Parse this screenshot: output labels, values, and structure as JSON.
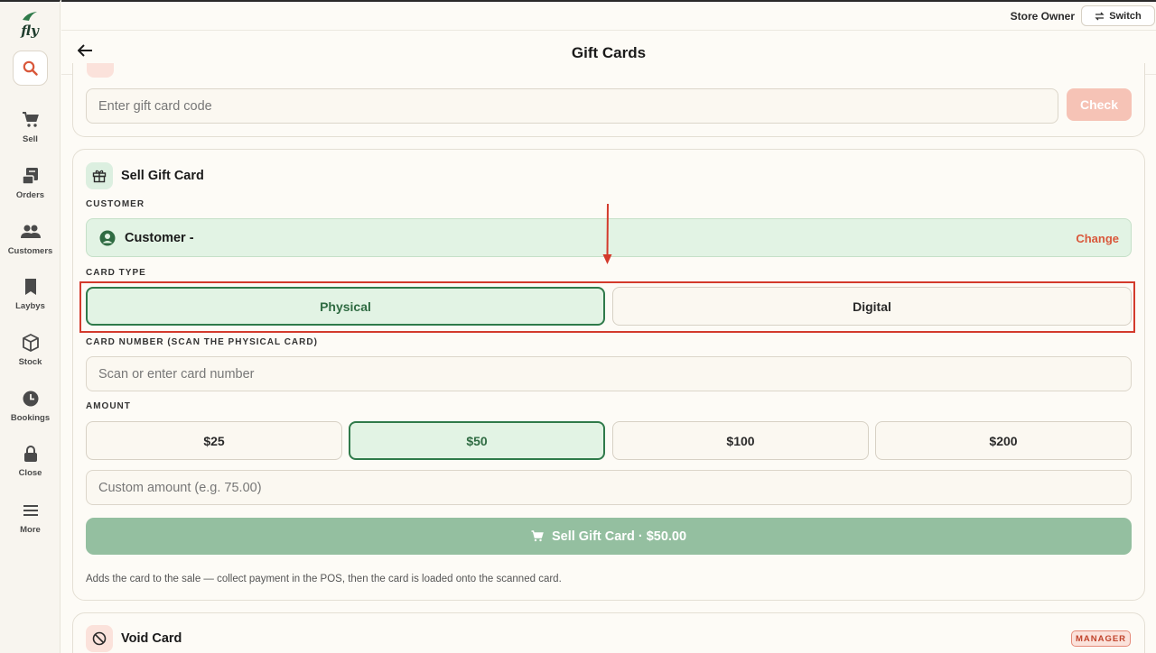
{
  "app": {
    "logo_text": "fly"
  },
  "sidebar": {
    "items": [
      {
        "label": "Sell",
        "icon": "cart-icon"
      },
      {
        "label": "Orders",
        "icon": "receipt-icon"
      },
      {
        "label": "Customers",
        "icon": "users-icon"
      },
      {
        "label": "Laybys",
        "icon": "bookmark-icon"
      },
      {
        "label": "Stock",
        "icon": "box-icon"
      },
      {
        "label": "Bookings",
        "icon": "clock-icon"
      },
      {
        "label": "Close",
        "icon": "lock-icon"
      },
      {
        "label": "More",
        "icon": "menu-icon"
      }
    ]
  },
  "topbar": {
    "user": "Store Owner",
    "switch_label": "Switch"
  },
  "header": {
    "title": "Gift Cards"
  },
  "check": {
    "placeholder": "Enter gift card code",
    "button": "Check"
  },
  "sell": {
    "title": "Sell Gift Card",
    "customer_label": "CUSTOMER",
    "customer_name": "Customer -",
    "change_label": "Change",
    "card_type_label": "CARD TYPE",
    "card_types": [
      "Physical",
      "Digital"
    ],
    "selected_card_type": "Physical",
    "card_number_label": "CARD NUMBER (SCAN THE PHYSICAL CARD)",
    "card_number_placeholder": "Scan or enter card number",
    "amount_label": "AMOUNT",
    "amounts": [
      "$25",
      "$50",
      "$100",
      "$200"
    ],
    "selected_amount": "$50",
    "custom_amount_placeholder": "Custom amount (e.g. 75.00)",
    "submit_label": "Sell Gift Card · $50.00",
    "hint": "Adds the card to the sale — collect payment in the POS, then the card is loaded onto the scanned card."
  },
  "void": {
    "title": "Void Card",
    "badge": "MANAGER"
  },
  "colors": {
    "accent_green": "#2f7a4a",
    "accent_orange": "#d9573a",
    "annotation_red": "#d33a2c"
  }
}
